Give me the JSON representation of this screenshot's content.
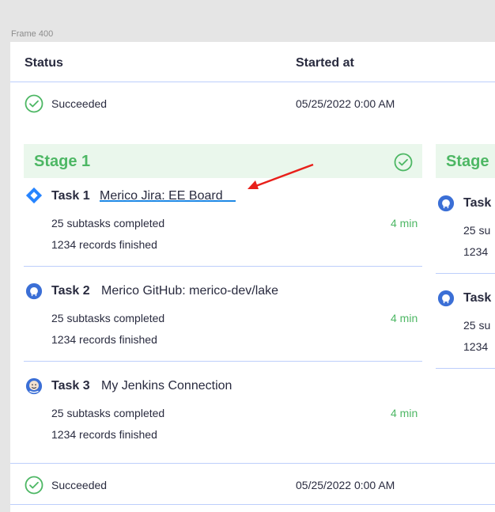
{
  "frame_label": "Frame 400",
  "header": {
    "status": "Status",
    "started_at": "Started at"
  },
  "rows": [
    {
      "status": "Succeeded",
      "started_at": "05/25/2022 0:00 AM"
    },
    {
      "status": "Succeeded",
      "started_at": "05/25/2022 0:00 AM"
    }
  ],
  "stages": [
    {
      "title": "Stage 1",
      "tasks": [
        {
          "name": "Task 1",
          "connection": "Merico Jira: EE Board",
          "subtasks": "25 subtasks completed",
          "records": "1234 records finished",
          "duration": "4 min",
          "icon": "jira-icon"
        },
        {
          "name": "Task 2",
          "connection": "Merico GitHub: merico-dev/lake",
          "subtasks": "25 subtasks completed",
          "records": "1234 records finished",
          "duration": "4 min",
          "icon": "github-icon"
        },
        {
          "name": "Task 3",
          "connection": "My Jenkins Connection",
          "subtasks": "25 subtasks completed",
          "records": "1234 records finished",
          "duration": "4 min",
          "icon": "jenkins-icon"
        }
      ]
    },
    {
      "title": "Stage",
      "tasks": [
        {
          "name": "Task",
          "subtasks": "25 su",
          "records": "1234",
          "icon": "github-icon"
        },
        {
          "name": "Task",
          "subtasks": "25 su",
          "records": "1234",
          "icon": "github-icon"
        }
      ]
    }
  ],
  "colors": {
    "success": "#4db764",
    "stage_bg": "#eaf7ec",
    "divider": "#bdcefb",
    "annotation_arrow": "#e8201a",
    "annotation_underline": "#1e88e5"
  }
}
